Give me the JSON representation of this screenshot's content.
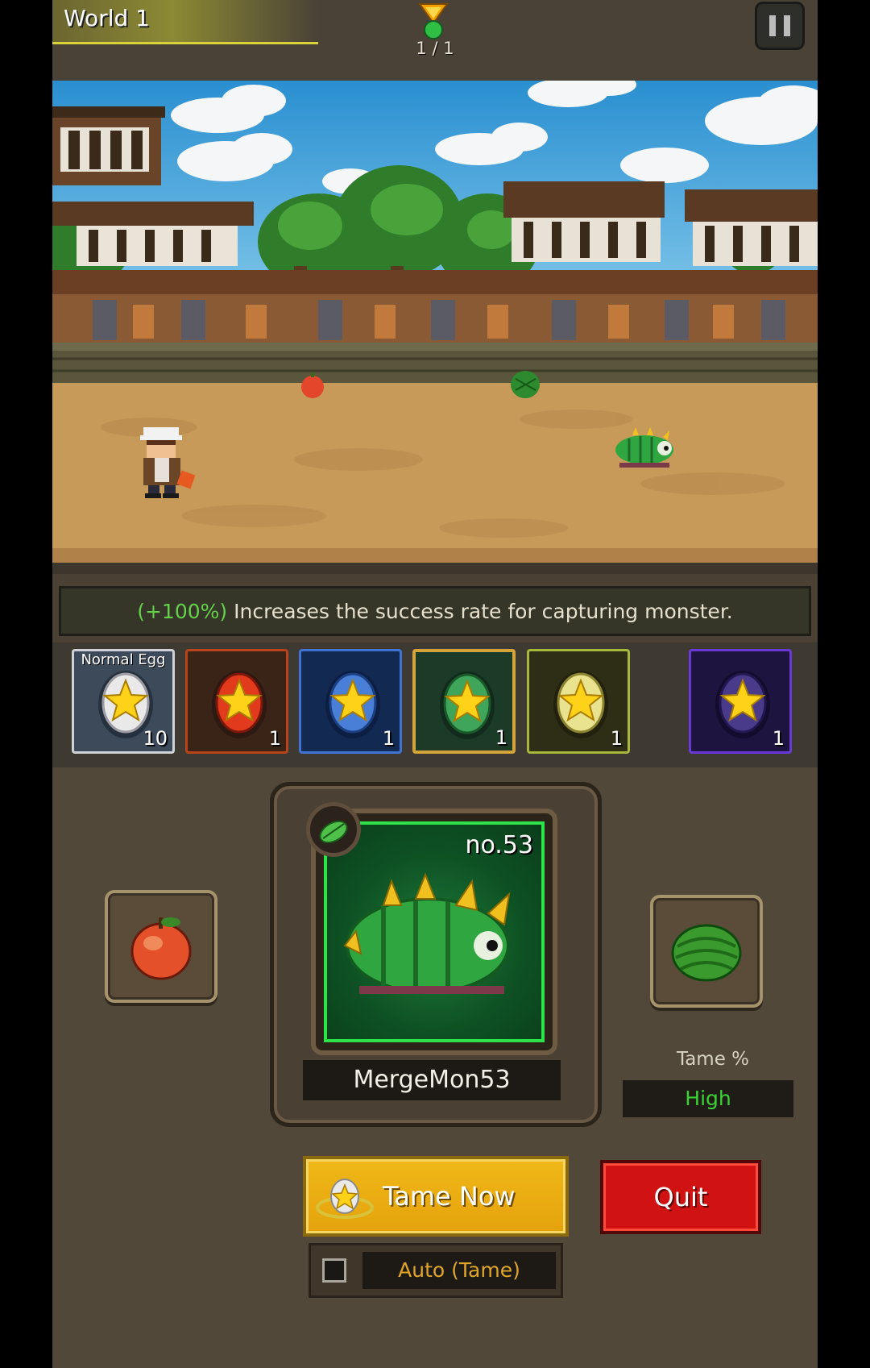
{
  "header": {
    "world_title": "World 1",
    "stage_progress": "1 / 1"
  },
  "hint": {
    "percent": "(+100%)",
    "text": " Increases the success rate for capturing monster."
  },
  "eggs": [
    {
      "label": "Normal Egg",
      "count": "10",
      "color": "#e9e9ea"
    },
    {
      "label": "",
      "count": "1",
      "color": "#e23a1c"
    },
    {
      "label": "",
      "count": "1",
      "color": "#4a7fd8"
    },
    {
      "label": "",
      "count": "1",
      "color": "#3fa55a"
    },
    {
      "label": "",
      "count": "1",
      "color": "#e9e38f"
    },
    {
      "label": "",
      "count": "1",
      "color": "#4a3a8a"
    }
  ],
  "monster": {
    "number": "no.53",
    "name": "MergeMon53"
  },
  "tame": {
    "label": "Tame %",
    "value": "High"
  },
  "buttons": {
    "tame_now": "Tame Now",
    "quit": "Quit",
    "auto_tame": "Auto (Tame)"
  }
}
